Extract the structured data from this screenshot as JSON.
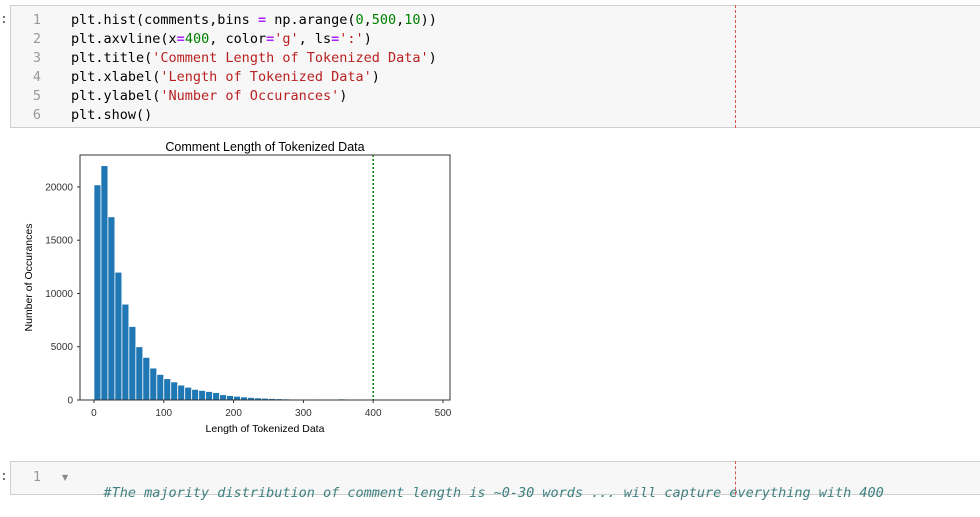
{
  "cell1": {
    "prompt": ":",
    "line_numbers": [
      "1",
      "2",
      "3",
      "4",
      "5",
      "6"
    ],
    "lines": [
      [
        {
          "t": "plt.hist(comments,bins ",
          "c": ""
        },
        {
          "t": "=",
          "c": "op"
        },
        {
          "t": " np.arange(",
          "c": ""
        },
        {
          "t": "0",
          "c": "num"
        },
        {
          "t": ",",
          "c": ""
        },
        {
          "t": "500",
          "c": "num"
        },
        {
          "t": ",",
          "c": ""
        },
        {
          "t": "10",
          "c": "num"
        },
        {
          "t": "))",
          "c": ""
        }
      ],
      [
        {
          "t": "plt.axvline(x",
          "c": ""
        },
        {
          "t": "=",
          "c": "op"
        },
        {
          "t": "400",
          "c": "num"
        },
        {
          "t": ", color",
          "c": ""
        },
        {
          "t": "=",
          "c": "op"
        },
        {
          "t": "'g'",
          "c": "str"
        },
        {
          "t": ", ls",
          "c": ""
        },
        {
          "t": "=",
          "c": "op"
        },
        {
          "t": "':'",
          "c": "str"
        },
        {
          "t": ")",
          "c": ""
        }
      ],
      [
        {
          "t": "plt.title(",
          "c": ""
        },
        {
          "t": "'Comment Length of Tokenized Data'",
          "c": "str"
        },
        {
          "t": ")",
          "c": ""
        }
      ],
      [
        {
          "t": "plt.xlabel(",
          "c": ""
        },
        {
          "t": "'Length of Tokenized Data'",
          "c": "str"
        },
        {
          "t": ")",
          "c": ""
        }
      ],
      [
        {
          "t": "plt.ylabel(",
          "c": ""
        },
        {
          "t": "'Number of Occurances'",
          "c": "str"
        },
        {
          "t": ")",
          "c": ""
        }
      ],
      [
        {
          "t": "plt.show()",
          "c": ""
        }
      ]
    ]
  },
  "cell2": {
    "prompt": ":",
    "line_numbers": [
      "1"
    ],
    "fold_icon": "triangle-down",
    "comment": "#The majority distribution of comment length is ~0-30 words ... will capture everything with 400"
  },
  "colors": {
    "bar": "#1f77b4",
    "vline": "#008000",
    "ruler": "#d9534f"
  },
  "chart_data": {
    "type": "bar",
    "title": "Comment Length of Tokenized Data",
    "xlabel": "Length of Tokenized Data",
    "ylabel": "Number of Occurances",
    "bin_width": 10,
    "bin_starts": [
      0,
      10,
      20,
      30,
      40,
      50,
      60,
      70,
      80,
      90,
      100,
      110,
      120,
      130,
      140,
      150,
      160,
      170,
      180,
      190,
      200,
      210,
      220,
      230,
      240,
      250,
      260,
      270,
      280,
      290,
      300,
      310,
      320,
      330,
      340,
      350,
      360,
      370,
      380,
      390,
      400,
      410,
      420,
      430,
      440,
      450,
      460,
      470,
      480,
      490
    ],
    "values": [
      20200,
      22000,
      17200,
      12000,
      9000,
      6900,
      5000,
      4000,
      3000,
      2400,
      2000,
      1700,
      1400,
      1200,
      1000,
      900,
      800,
      700,
      500,
      420,
      350,
      290,
      240,
      200,
      170,
      140,
      120,
      100,
      85,
      70,
      60,
      50,
      42,
      35,
      30,
      100,
      20,
      15,
      10,
      8,
      5,
      0,
      0,
      0,
      0,
      0,
      0,
      0,
      0,
      0
    ],
    "vline_x": 400,
    "xlim": [
      -20,
      510
    ],
    "ylim": [
      0,
      23000
    ],
    "xticks": [
      0,
      100,
      200,
      300,
      400,
      500
    ],
    "yticks": [
      0,
      5000,
      10000,
      15000,
      20000
    ],
    "grid": false
  }
}
